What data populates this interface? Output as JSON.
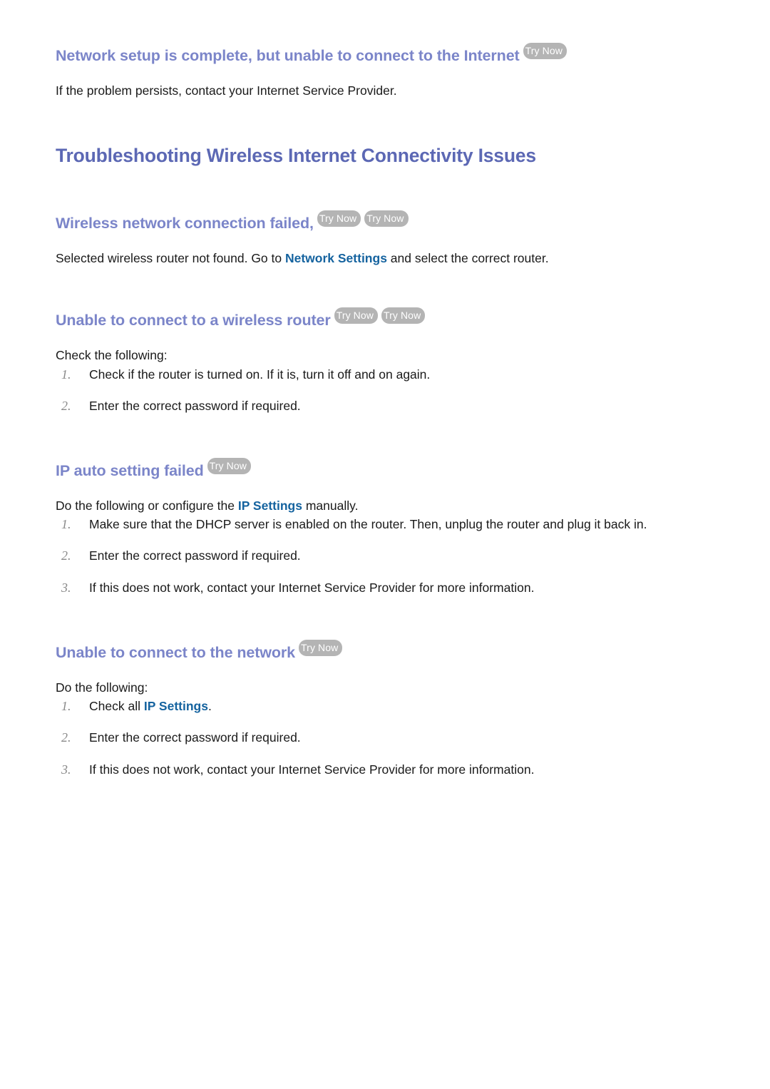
{
  "document": {
    "title": "Troubleshooting Wireless Internet Connectivity Issues",
    "accent_heading_color": "#5c68b4",
    "accent_subheading_color": "#7b85c9",
    "link_color": "#15639f",
    "badge_color": "#b4b4b4",
    "badge_text_color": "#ffffff",
    "body_color": "#1a1a1a",
    "background_color": "#ffffff"
  },
  "badges": {
    "try_now": "Try Now"
  },
  "sections": [
    {
      "id": "network-setup-complete",
      "heading": "Network setup is complete, but unable to connect to the Internet",
      "badge_count": 1,
      "paragraph": "If the problem persists, contact your Internet Service Provider."
    },
    {
      "id": "wireless-network-connection-failed",
      "heading": "Wireless network connection failed,",
      "badge_count": 2,
      "paragraph_pre": "Selected wireless router not found. Go to ",
      "paragraph_link": "Network Settings",
      "paragraph_post": " and select the correct router."
    },
    {
      "id": "unable-to-connect-wireless-router",
      "heading": "Unable to connect to a wireless router",
      "badge_count": 2,
      "intro": "Check the following:",
      "steps": [
        {
          "num": "1.",
          "text": "Check if the router is turned on. If it is, turn it off and on again."
        },
        {
          "num": "2.",
          "text": "Enter the correct password if required."
        }
      ]
    },
    {
      "id": "ip-auto-setting-failed",
      "heading": "IP auto setting failed",
      "badge_count": 1,
      "intro_pre": "Do the following or configure the ",
      "intro_link": "IP Settings",
      "intro_post": " manually.",
      "steps": [
        {
          "num": "1.",
          "text": "Make sure that the DHCP server is enabled on the router. Then, unplug the router and plug it back in."
        },
        {
          "num": "2.",
          "text": "Enter the correct password if required."
        },
        {
          "num": "3.",
          "text": "If this does not work, contact your Internet Service Provider for more information."
        }
      ]
    },
    {
      "id": "unable-to-connect-network",
      "heading": "Unable to connect to the network",
      "badge_count": 1,
      "intro": "Do the following:",
      "steps": [
        {
          "num": "1.",
          "text_pre": "Check all ",
          "text_link": "IP Settings",
          "text_post": "."
        },
        {
          "num": "2.",
          "text": "Enter the correct password if required."
        },
        {
          "num": "3.",
          "text": "If this does not work, contact your Internet Service Provider for more information."
        }
      ]
    }
  ]
}
